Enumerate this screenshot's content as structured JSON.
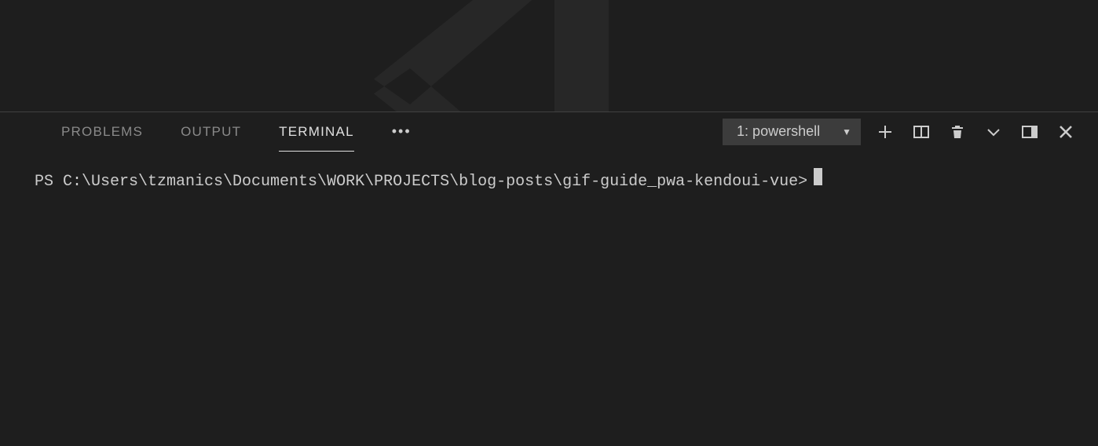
{
  "panel": {
    "tabs": {
      "problems": "PROBLEMS",
      "output": "OUTPUT",
      "terminal": "TERMINAL"
    }
  },
  "terminal": {
    "dropdown": {
      "selected": "1: powershell"
    },
    "prompt": "PS C:\\Users\\tzmanics\\Documents\\WORK\\PROJECTS\\blog-posts\\gif-guide_pwa-kendoui-vue>"
  }
}
